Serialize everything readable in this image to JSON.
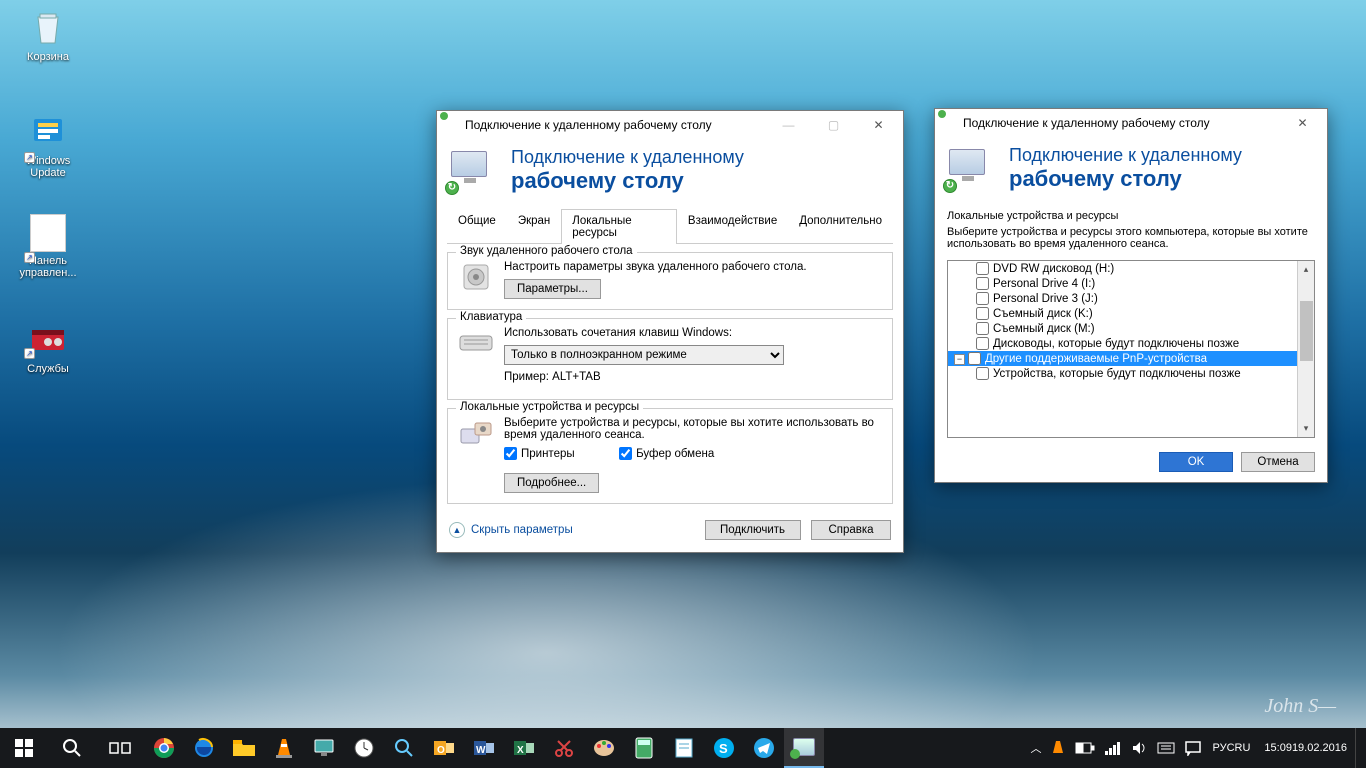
{
  "desktop_icons": [
    {
      "name": "Корзина",
      "kind": "recycle-bin"
    },
    {
      "name": "Windows Update",
      "kind": "windows-update",
      "shortcut": true
    },
    {
      "name": "Панель управлен...",
      "kind": "control-panel",
      "shortcut": true
    },
    {
      "name": "Службы",
      "kind": "services",
      "shortcut": true
    }
  ],
  "win1": {
    "title": "Подключение к удаленному рабочему столу",
    "header_l1": "Подключение к удаленному",
    "header_l2": "рабочему столу",
    "tabs": [
      "Общие",
      "Экран",
      "Локальные ресурсы",
      "Взаимодействие",
      "Дополнительно"
    ],
    "active_tab": 2,
    "audio": {
      "legend": "Звук удаленного рабочего стола",
      "desc": "Настроить параметры звука удаленного рабочего стола.",
      "btn": "Параметры..."
    },
    "kb": {
      "legend": "Клавиатура",
      "desc": "Использовать сочетания клавиш Windows:",
      "opt": "Только в полноэкранном режиме",
      "example": "Пример: ALT+TAB"
    },
    "local": {
      "legend": "Локальные устройства и ресурсы",
      "desc": "Выберите устройства и ресурсы, которые вы хотите использовать во время удаленного сеанса.",
      "c1": "Принтеры",
      "c2": "Буфер обмена",
      "btn": "Подробнее..."
    },
    "footer": {
      "hide": "Скрыть параметры",
      "connect": "Подключить",
      "help": "Справка"
    }
  },
  "win2": {
    "title": "Подключение к удаленному рабочему столу",
    "header_l1": "Подключение к удаленному",
    "header_l2": "рабочему столу",
    "group": "Локальные устройства и ресурсы",
    "desc": "Выберите устройства и ресурсы этого компьютера, которые вы хотите использовать во время удаленного сеанса.",
    "items": [
      "DVD RW дисковод (H:)",
      "Personal Drive 4 (I:)",
      "Personal Drive 3 (J:)",
      "Съемный диск (K:)",
      "Съемный диск (M:)",
      "Дисководы, которые будут подключены позже",
      "Другие поддерживаемые PnP-устройства",
      "Устройства, которые будут подключены позже"
    ],
    "selected_index": 6,
    "ok": "OK",
    "cancel": "Отмена"
  },
  "taskbar": {
    "time": "15:09",
    "date": "19.02.2016",
    "lang1": "РУС",
    "lang2": "RU"
  }
}
